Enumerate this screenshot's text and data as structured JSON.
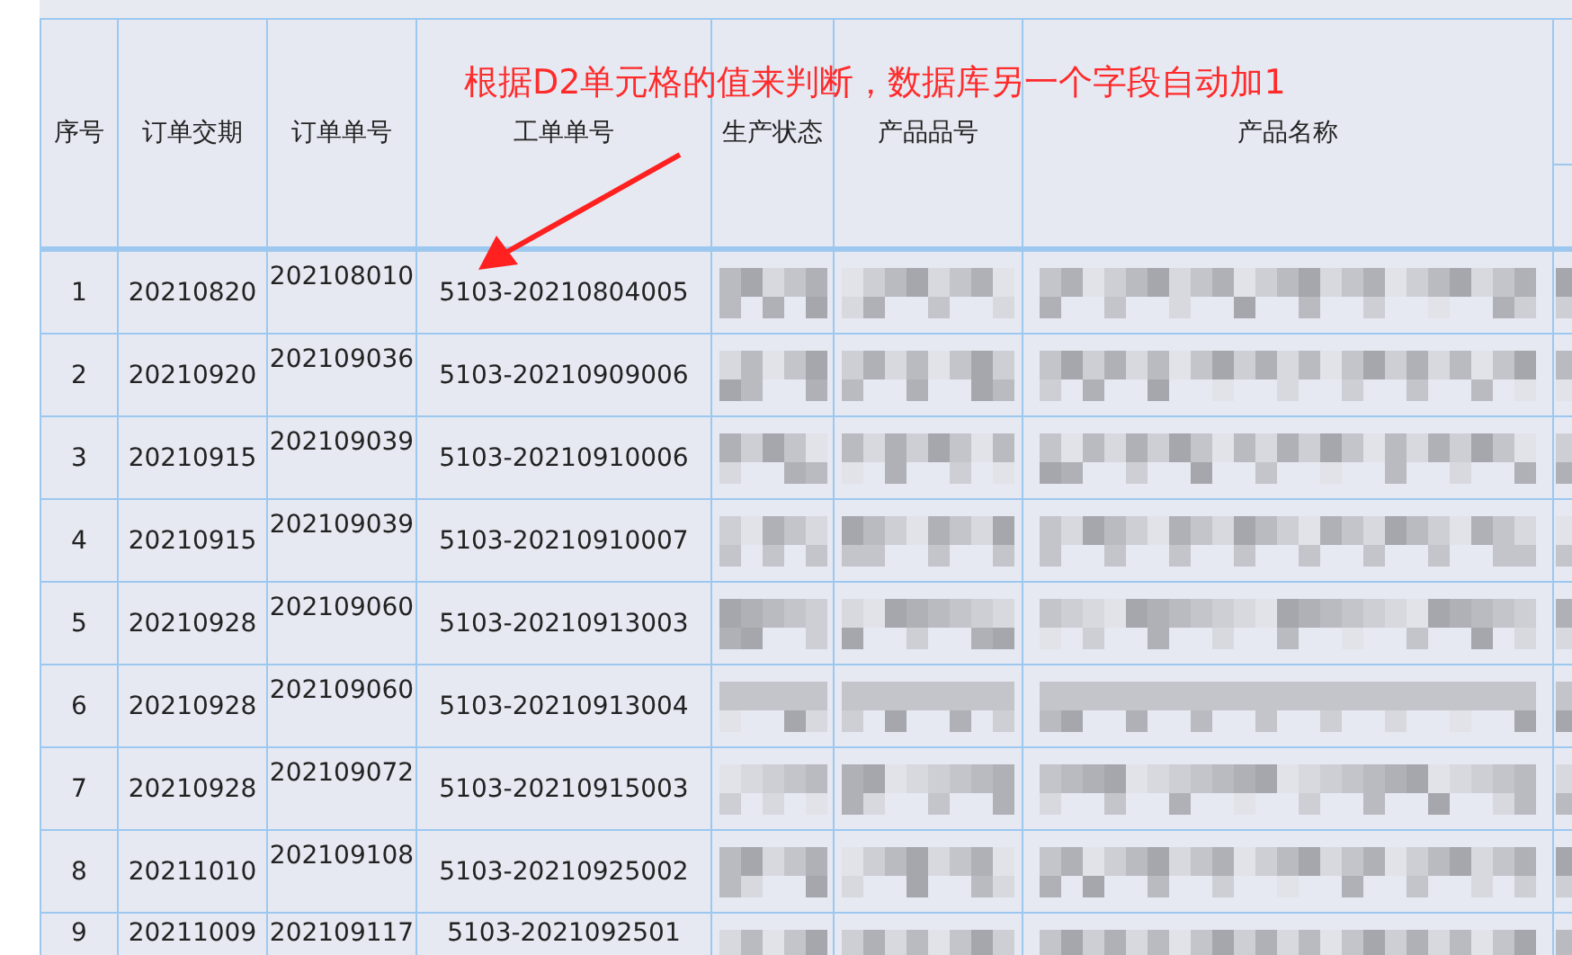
{
  "annotation": {
    "text": "根据D2单元格的值来判断，数据库另一个字段自动加1"
  },
  "table": {
    "columns": [
      "序号",
      "订单交期",
      "订单单号",
      "工单单号",
      "生产状态",
      "产品品号",
      "产品名称"
    ],
    "rows": [
      {
        "cells": [
          "1",
          "20210820",
          "202108010",
          "5103-20210804005"
        ]
      },
      {
        "cells": [
          "2",
          "20210920",
          "202109036",
          "5103-20210909006"
        ]
      },
      {
        "cells": [
          "3",
          "20210915",
          "202109039",
          "5103-20210910006"
        ]
      },
      {
        "cells": [
          "4",
          "20210915",
          "202109039",
          "5103-20210910007"
        ]
      },
      {
        "cells": [
          "5",
          "20210928",
          "202109060",
          "5103-20210913003"
        ]
      },
      {
        "cells": [
          "6",
          "20210928",
          "202109060",
          "5103-20210913004"
        ]
      },
      {
        "cells": [
          "7",
          "20210928",
          "202109072",
          "5103-20210915003"
        ]
      },
      {
        "cells": [
          "8",
          "20211010",
          "202109108",
          "5103-20210925002"
        ]
      },
      {
        "cells": [
          "9",
          "20211009",
          "202109117",
          "5103-2021092501"
        ]
      }
    ]
  }
}
